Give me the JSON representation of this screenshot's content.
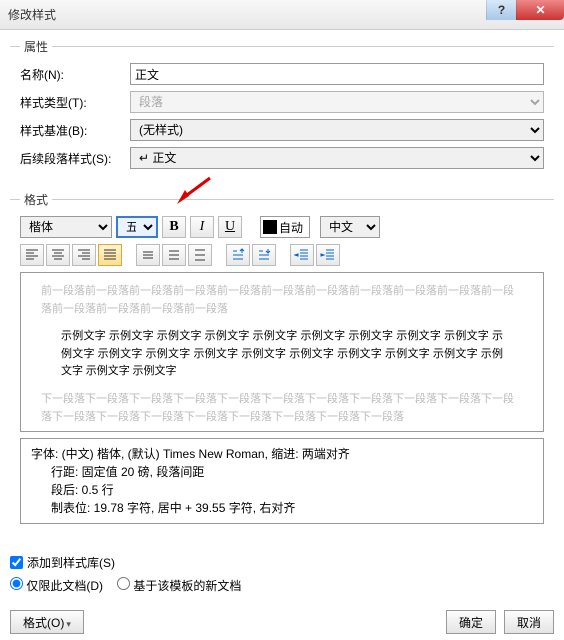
{
  "title": "修改样式",
  "groups": {
    "props": "属性",
    "format": "格式"
  },
  "props": {
    "name_label": "名称(N):",
    "name_value": "正文",
    "type_label": "样式类型(T):",
    "type_value": "段落",
    "base_label": "样式基准(B):",
    "base_value": "(无样式)",
    "next_label": "后续段落样式(S):",
    "next_value": "↵ 正文"
  },
  "format": {
    "font": "楷体",
    "size": "五号",
    "bold": "B",
    "italic": "I",
    "underline": "U",
    "auto": "自动",
    "lang": "中文"
  },
  "preview": {
    "gray_before": "前一段落前一段落前一段落前一段落前一段落前一段落前一段落前一段落前一段落前一段落前一段落前一段落前一段落前一段落前一段落",
    "sample": "示例文字 示例文字 示例文字 示例文字 示例文字 示例文字 示例文字 示例文字 示例文字 示例文字 示例文字 示例文字 示例文字 示例文字 示例文字 示例文字 示例文字 示例文字 示例文字 示例文字 示例文字",
    "gray_after": "下一段落下一段落下一段落下一段落下一段落下一段落下一段落下一段落下一段落下一段落下一段落下一段落下一段落下一段落下一段落下一段落下一段落下一段落下一段落"
  },
  "desc": {
    "l1": "字体: (中文) 楷体, (默认) Times New Roman, 缩进: 两端对齐",
    "l2": "行距: 固定值 20 磅, 段落间距",
    "l3": "段后: 0.5 行",
    "l4": "制表位:  19.78 字符, 居中 +  39.55 字符, 右对齐"
  },
  "options": {
    "add_to_lib": "添加到样式库(S)",
    "only_doc": "仅限此文档(D)",
    "based_tpl": "基于该模板的新文档"
  },
  "buttons": {
    "format": "格式(O)",
    "ok": "确定",
    "cancel": "取消"
  }
}
